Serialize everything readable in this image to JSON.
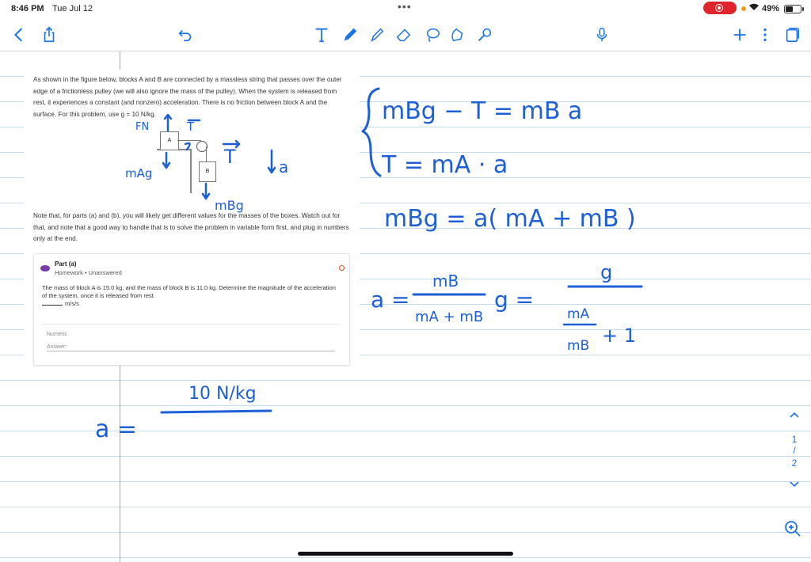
{
  "status_bar": {
    "time": "8:46 PM",
    "date": "Tue Jul 12",
    "battery": "49%",
    "dots": "•••"
  },
  "toolbar": {
    "items": [
      "back-icon",
      "share-icon",
      "undo-icon",
      "text-tool-icon",
      "pen-icon",
      "highlighter-icon",
      "eraser-icon",
      "lasso-icon",
      "image-tool-icon",
      "shape-tool-icon",
      "microphone-icon",
      "add-icon",
      "more-icon",
      "pages-icon"
    ],
    "accent": "#1a73e8"
  },
  "problem": {
    "intro": "As shown in the figure below, blocks A and B are connected by a massless string that passes over the outer edge of a frictionless pulley (we will also ignore the mass of the pulley). When the system is released from rest, it experiences a constant (and nonzero) acceleration. There is no friction between block A and the surface. For this problem, use g = 10 N/kg.",
    "block_a": "A",
    "block_b": "B",
    "note": "Note that, for parts (a) and (b), you will likely get different values for the masses of the boxes. Watch out for that, and note that a good way to handle that is to solve the problem in variable form first, and plug in numbers only at the end.",
    "part": {
      "title": "Part (a)",
      "subtitle": "Homework • Unanswered",
      "question": "The mass of block A is 15.0 kg, and the mass of block B is 11.0 kg. Determine the magnitude of the acceleration of the system, once it is released from rest.",
      "units": "m/s/s",
      "numeric_label": "Numeric",
      "answer_label": "Answer:"
    }
  },
  "handwriting": {
    "fn": "FN",
    "t_top": "T",
    "t_right": "T",
    "mag": "mAg",
    "a_vec": "a",
    "mbg": "mBg",
    "eq1": "mBg − T = mB a",
    "eq2": "T = mA · a",
    "eq3": "mBg = a( mA + mB )",
    "eq4_lhs": "a =",
    "eq4_num": "mB",
    "eq4_den": "mA + mB",
    "eq4_g": "g  =",
    "eq4_rnum": "g",
    "eq4_rden_num": "mA",
    "eq4_rden_den": "mB",
    "eq4_plus1": "+ 1",
    "bottom_lhs": "a =",
    "bottom_num": "10 N/kg",
    "ink_color": "#1d5fd6"
  },
  "page_controls": {
    "current": "1",
    "total": "2",
    "separator": "/"
  }
}
